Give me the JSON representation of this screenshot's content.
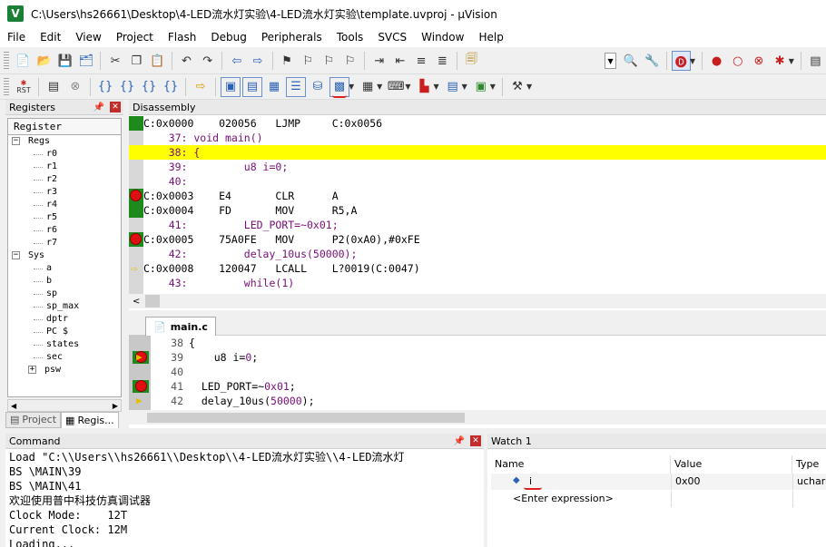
{
  "window": {
    "title": "C:\\Users\\hs26661\\Desktop\\4-LED流水灯实验\\4-LED流水灯实验\\template.uvproj - µVision",
    "app_icon": "V"
  },
  "menu": [
    "File",
    "Edit",
    "View",
    "Project",
    "Flash",
    "Debug",
    "Peripherals",
    "Tools",
    "SVCS",
    "Window",
    "Help"
  ],
  "toolbar1_icons": [
    "new-file-icon",
    "open-icon",
    "save-icon",
    "save-all-icon",
    "cut-icon",
    "copy-icon",
    "paste-icon",
    "undo-icon",
    "redo-icon",
    "nav-back-icon",
    "nav-forward-icon",
    "bookmark-icon",
    "bookmark-prev-icon",
    "bookmark-next-icon",
    "bookmark-clear-icon",
    "indent-icon",
    "unindent-icon",
    "comment-icon",
    "uncomment-icon",
    "find-in-files-icon",
    "target-combo-icon",
    "find-icon",
    "debug-session-icon",
    "insert-breakpoint-icon",
    "enable-breakpoint-icon",
    "disable-breakpoint-icon",
    "kill-breakpoints-icon",
    "config-icon"
  ],
  "toolbar2": {
    "reset_label": "RST"
  },
  "registers": {
    "title": "Registers",
    "column": "Register",
    "tree": [
      {
        "label": "Regs",
        "level": 0,
        "box": "−"
      },
      {
        "label": "r0",
        "level": 2
      },
      {
        "label": "r1",
        "level": 2
      },
      {
        "label": "r2",
        "level": 2
      },
      {
        "label": "r3",
        "level": 2
      },
      {
        "label": "r4",
        "level": 2
      },
      {
        "label": "r5",
        "level": 2
      },
      {
        "label": "r6",
        "level": 2
      },
      {
        "label": "r7",
        "level": 2
      },
      {
        "label": "Sys",
        "level": 0,
        "box": "−"
      },
      {
        "label": "a",
        "level": 2
      },
      {
        "label": "b",
        "level": 2
      },
      {
        "label": "sp",
        "level": 2
      },
      {
        "label": "sp_max",
        "level": 2
      },
      {
        "label": "dptr",
        "level": 2
      },
      {
        "label": "PC  $",
        "level": 2
      },
      {
        "label": "states",
        "level": 2
      },
      {
        "label": "sec",
        "level": 2
      },
      {
        "label": "psw",
        "level": 1,
        "box": "+"
      }
    ],
    "tabs": [
      "Project",
      "Regis..."
    ]
  },
  "disassembly": {
    "title": "Disassembly",
    "lines": [
      {
        "text": "C:0x0000    020056   LJMP     C:0x0056",
        "kind": "asm",
        "marker": "green"
      },
      {
        "text": "    37: void main()",
        "kind": "src"
      },
      {
        "text": "    38: {",
        "kind": "src",
        "highlight": true
      },
      {
        "text": "    39:         u8 i=0;",
        "kind": "src"
      },
      {
        "text": "    40: ",
        "kind": "src"
      },
      {
        "text": "C:0x0003    E4       CLR      A",
        "kind": "asm",
        "marker": "bp"
      },
      {
        "text": "C:0x0004    FD       MOV      R5,A",
        "kind": "asm",
        "marker": "green"
      },
      {
        "text": "    41:         LED_PORT=~0x01;",
        "kind": "src"
      },
      {
        "text": "C:0x0005    75A0FE   MOV      P2(0xA0),#0xFE",
        "kind": "asm",
        "marker": "bp"
      },
      {
        "text": "    42:         delay_10us(50000);",
        "kind": "src"
      },
      {
        "text": "C:0x0008    120047   LCALL    L?0019(C:0047)",
        "kind": "asm",
        "marker": "arrow"
      },
      {
        "text": "    43:         while(1)",
        "kind": "src"
      }
    ]
  },
  "editor": {
    "tab": "main.c",
    "lines": [
      {
        "num": "38",
        "code": "{",
        "marker": ""
      },
      {
        "num": "39",
        "code": "    u8 i=0;",
        "marker": "bp-arrow"
      },
      {
        "num": "40",
        "code": "",
        "marker": ""
      },
      {
        "num": "41",
        "code": "  LED_PORT=~0x01;",
        "marker": "bp"
      },
      {
        "num": "42",
        "code": "  delay_10us(50000);",
        "marker": "arrow"
      }
    ]
  },
  "command": {
    "title": "Command",
    "lines": [
      "Load \"C:\\\\Users\\\\hs26661\\\\Desktop\\\\4-LED流水灯实验\\\\4-LED流水灯",
      "BS \\MAIN\\39",
      "BS \\MAIN\\41",
      "欢迎使用普中科技仿真调试器",
      "Clock Mode:    12T",
      "Current Clock: 12M",
      "Loading..."
    ]
  },
  "watch": {
    "title": "Watch 1",
    "columns": [
      "Name",
      "Value",
      "Type"
    ],
    "rows": [
      {
        "name": "i",
        "value": "0x00",
        "type": "uchar"
      },
      {
        "name": "<Enter expression>",
        "value": "",
        "type": ""
      }
    ]
  },
  "colors": {
    "highlight": "#ffff00",
    "marker_green": "#1e8a1e",
    "breakpoint": "#e01010",
    "annotation_red": "#e02020"
  }
}
